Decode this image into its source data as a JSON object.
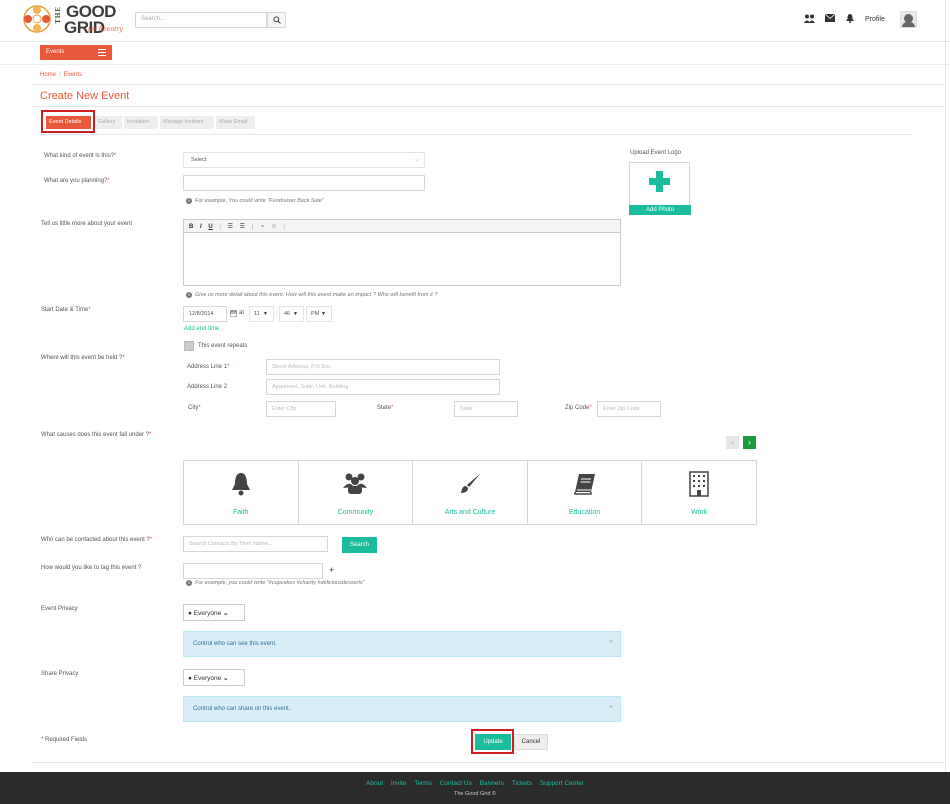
{
  "header": {
    "logo": {
      "the": "THE",
      "good": "GOOD",
      "grid": "GRID",
      "sub": "for Reentry"
    },
    "search_placeholder": "Search...",
    "profile_label": "Profile"
  },
  "nav": {
    "events_button": "Events"
  },
  "breadcrumb": {
    "home": "Home",
    "sep": "/",
    "current": "Events"
  },
  "page_title": "Create New Event",
  "tabs": [
    {
      "label": "Event Details"
    },
    {
      "label": "Gallery"
    },
    {
      "label": "Invitation"
    },
    {
      "label": "Manage Invitees"
    },
    {
      "label": "Mass Email"
    }
  ],
  "form": {
    "kind_label": "What kind of event is this?",
    "kind_value": "Select",
    "planning_label": "What are you planning?",
    "planning_hint": "For example, You could write \"Fundraiser Back Sale\"",
    "upload_label": "Upload Event Logo",
    "upload_button": "Add Photo",
    "more_label": "Tell us little more about your event",
    "more_hint": "Give us more detail about this event, How will this event make an impact ? Who will benefit from it ?",
    "editor_tools": [
      "B",
      "I",
      "U",
      "|",
      "☰",
      "☰",
      "|",
      "⚭",
      "⊘",
      "|"
    ],
    "date_label": "Start Date & Time",
    "date_value": "12/8/2014",
    "at_label": "at",
    "hour_value": "11",
    "colon": ":",
    "minute_value": "46",
    "ampm_value": "PM",
    "add_end_time": "Add end time",
    "repeats_label": "This event repeats",
    "where_label": "Where will this event be held ?",
    "address1_label": "Address Line 1",
    "address1_placeholder": "Street Address, P.O Box",
    "address2_label": "Address Line 2",
    "address2_placeholder": "Apartment, Suite, Unit, Building",
    "city_label": "City",
    "city_placeholder": "Enter City",
    "state_label": "State",
    "state_placeholder": "State",
    "zip_label": "Zip Code",
    "zip_placeholder": "Enter Zip Code",
    "causes_label": "What causes does this event fall under ?",
    "causes": [
      {
        "label": "Faith",
        "icon": "bell-icon"
      },
      {
        "label": "Community",
        "icon": "group-icon"
      },
      {
        "label": "Arts and Culture",
        "icon": "brush-icon"
      },
      {
        "label": "Education",
        "icon": "book-icon"
      },
      {
        "label": "Work",
        "icon": "building-icon"
      }
    ],
    "contact_label": "Who can be contacted about this event ?",
    "contact_placeholder": "Search Contacts By Their Name...",
    "contact_search_button": "Search",
    "tag_label": "How would you like to tag this event ?",
    "tag_plus": "+",
    "tag_hint": "For example, you could write \"#cupcakes #charity #deliciousdesserts\"",
    "event_privacy_label": "Event Privacy",
    "event_privacy_value": "Everyone",
    "event_privacy_alert": "Control who can see this event.",
    "share_privacy_label": "Share Privacy",
    "share_privacy_value": "Everyone",
    "share_privacy_alert": "Control who can share on this event.",
    "required_note": "* Required Fields",
    "update_button": "Update",
    "cancel_button": "Cancel",
    "required_mark": "*",
    "close_mark": "×",
    "info_mark": "i"
  },
  "footer": {
    "links": [
      "About",
      "Invite",
      "Terms",
      "Contact Us",
      "Banners",
      "Tickets",
      "Support Center"
    ],
    "copyright": "The Good Grid ©"
  },
  "colors": {
    "accent": "#e8583b",
    "teal": "#1bbc9b",
    "alert_bg": "#d9edf7",
    "footer_bg": "#2b2b2b"
  }
}
